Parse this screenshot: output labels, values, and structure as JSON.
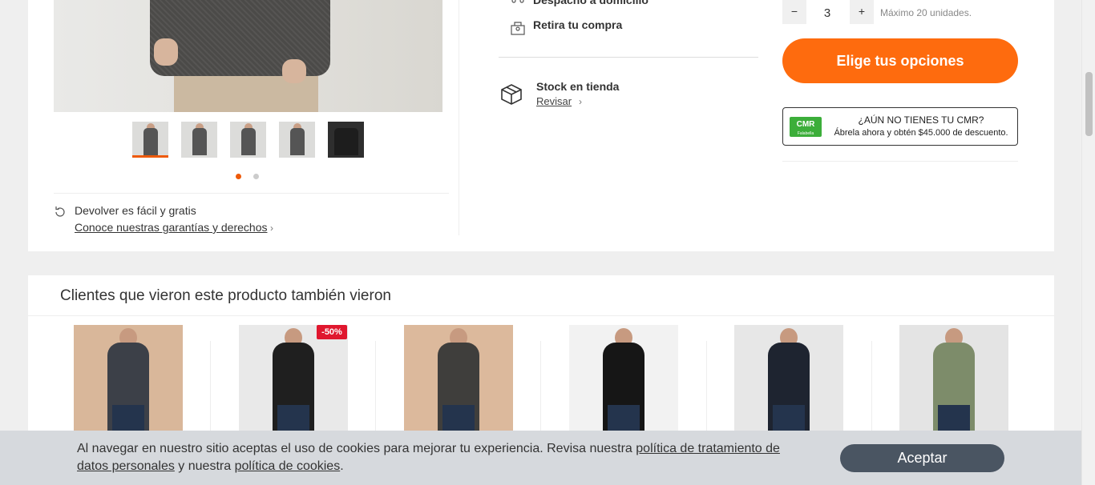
{
  "delivery": {
    "home_delivery": "Despacho a domicilio",
    "pickup": "Retira tu compra"
  },
  "stock": {
    "title": "Stock en tienda",
    "link": "Revisar"
  },
  "returns": {
    "title": "Devolver es fácil y gratis",
    "link": "Conoce nuestras garantías y derechos"
  },
  "quantity": {
    "minus": "−",
    "value": "3",
    "plus": "+",
    "max_note": "Máximo 20 unidades."
  },
  "cta": {
    "choose_options": "Elige tus opciones"
  },
  "cmr": {
    "logo": "CMR",
    "logo_sub": "Falabella",
    "line1": "¿AÚN NO TIENES TU CMR?",
    "line2": "Ábrela ahora y obtén $45.000 de descuento."
  },
  "gallery": {
    "thumb_count": 5,
    "active_thumb": 1,
    "dots": 2,
    "active_dot": 1
  },
  "recommendations": {
    "title": "Clientes que vieron este producto también vieron",
    "items": [
      {
        "badge": "",
        "bg": "#d9b79a",
        "coat": "#3c4048"
      },
      {
        "badge": "-50%",
        "bg": "#e9e9e9",
        "coat": "#1f1f1f"
      },
      {
        "badge": "",
        "bg": "#dcb99c",
        "coat": "#3f3e3c"
      },
      {
        "badge": "",
        "bg": "#f2f2f2",
        "coat": "#161616"
      },
      {
        "badge": "",
        "bg": "#e7e7e7",
        "coat": "#1e2430"
      },
      {
        "badge": "",
        "bg": "#e4e4e4",
        "coat": "#7d8c6a"
      }
    ]
  },
  "cookie_banner": {
    "text_before": "Al navegar en nuestro sitio aceptas el uso de cookies para mejorar tu experiencia. Revisa nuestra ",
    "link1": "política de tratamiento de datos personales",
    "text_middle": " y nuestra ",
    "link2": "política de cookies",
    "text_after": ".",
    "accept": "Aceptar"
  },
  "colors": {
    "accent": "#fe6b0e",
    "cmr_green": "#3cae3a",
    "discount_red": "#e0172e",
    "accept_button": "#4a5562"
  }
}
